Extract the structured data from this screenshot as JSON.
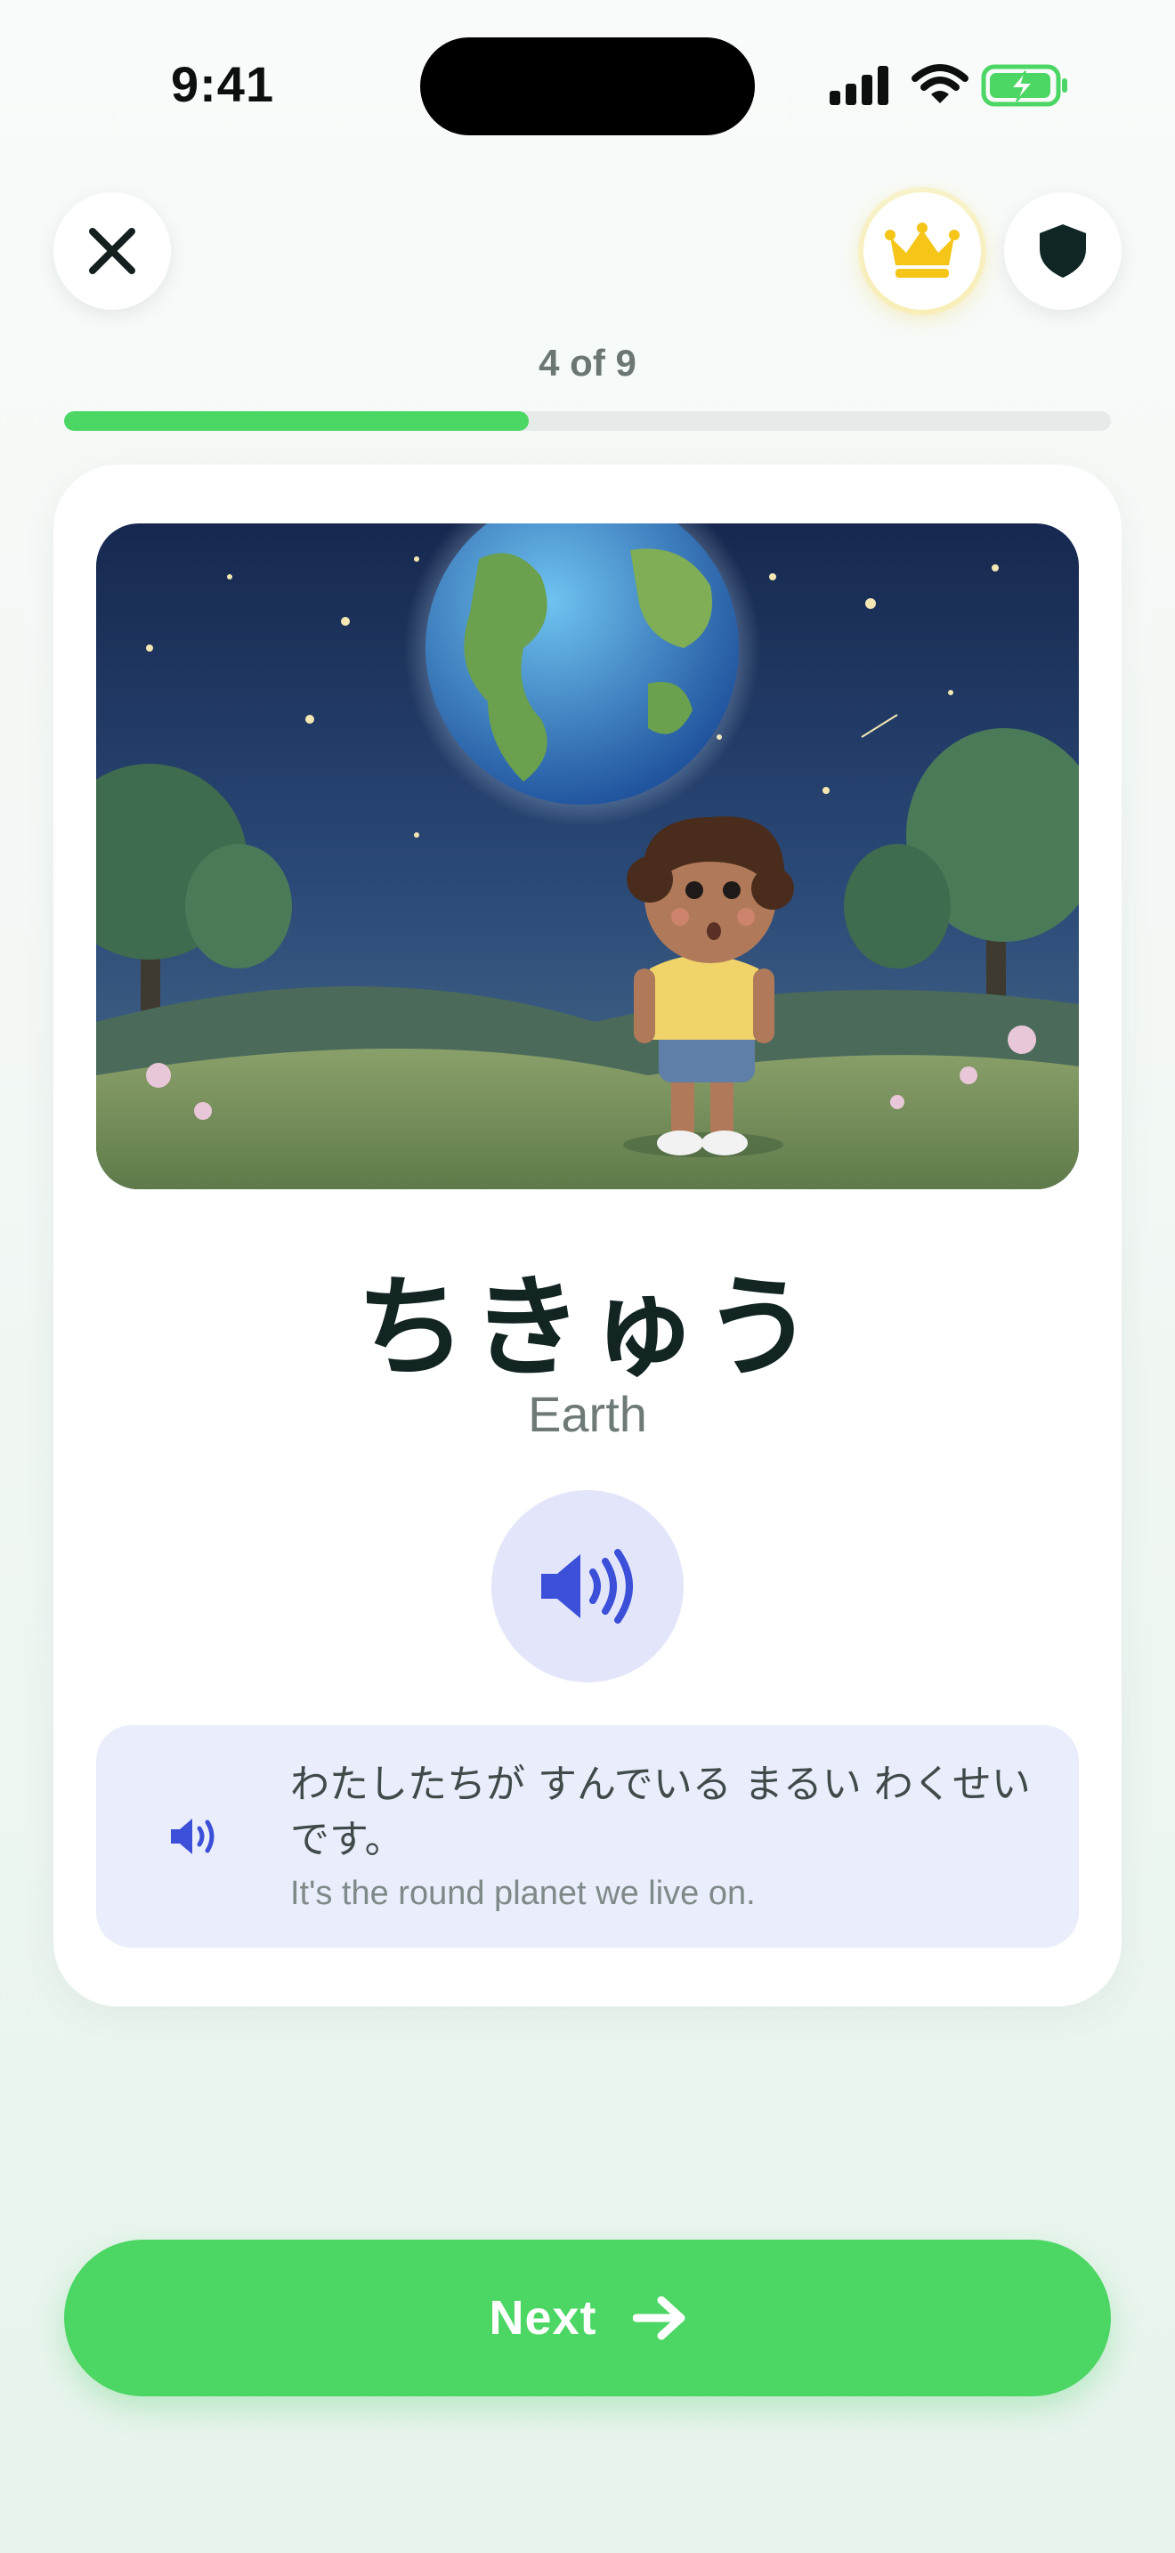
{
  "status_bar": {
    "time": "9:41"
  },
  "header": {
    "close_icon": "close-icon",
    "premium_icon": "crown-icon",
    "shield_icon": "shield-icon"
  },
  "progress": {
    "label": "4 of 9",
    "current": 4,
    "total": 9,
    "fraction": 0.444
  },
  "card": {
    "illustration_icon": "earth-night-boy-illustration",
    "word": "ちきゅう",
    "translation": "Earth",
    "speaker_icon": "speaker-icon",
    "example": {
      "japanese": "わたしたちが すんでいる まるい わくせいです。",
      "english": "It's the round planet we live on."
    }
  },
  "footer": {
    "next_label": "Next",
    "next_icon": "arrow-right-icon"
  },
  "colors": {
    "accent_green": "#4cd664",
    "speaker_blue": "#3b4fd8",
    "speaker_bg": "#e3e6fb",
    "crown_gold": "#f5c518"
  }
}
